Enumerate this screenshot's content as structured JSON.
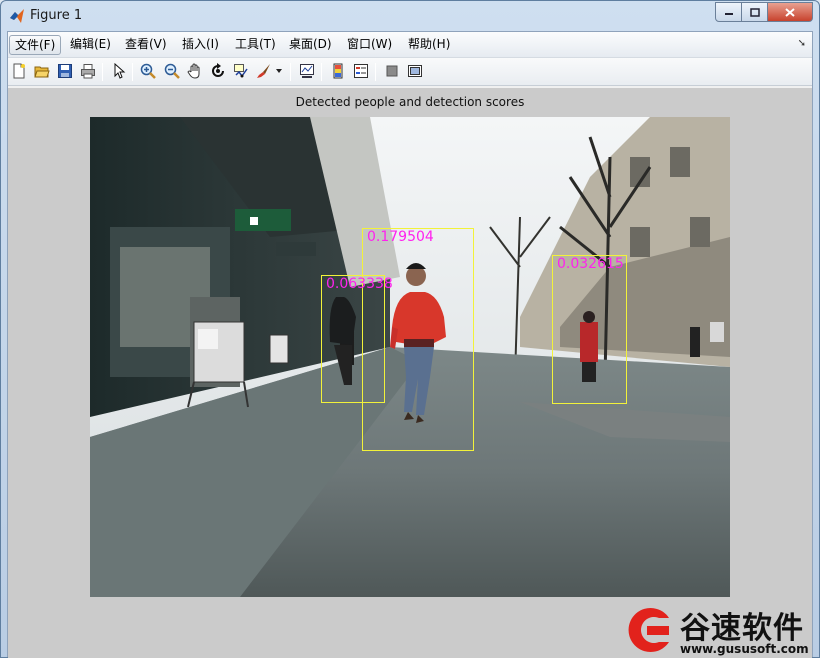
{
  "window": {
    "title": "Figure 1"
  },
  "menu": [
    {
      "label": "文件(F)",
      "active": true
    },
    {
      "label": "编辑(E)"
    },
    {
      "label": "查看(V)"
    },
    {
      "label": "插入(I)"
    },
    {
      "label": "工具(T)"
    },
    {
      "label": "桌面(D)"
    },
    {
      "label": "窗口(W)"
    },
    {
      "label": "帮助(H)"
    }
  ],
  "toolbar": {
    "icons": [
      "new-figure-icon",
      "open-file-icon",
      "save-icon",
      "print-icon",
      "edit-plot-icon",
      "zoom-in-icon",
      "zoom-out-icon",
      "pan-icon",
      "rotate-3d-icon",
      "data-cursor-icon",
      "brush-icon",
      "link-plot-icon",
      "colorbar-icon",
      "legend-icon",
      "hide-plot-tools-icon",
      "show-plot-tools-icon"
    ]
  },
  "figure": {
    "title": "Detected people and detection scores",
    "detections": [
      {
        "label": "0.179504"
      },
      {
        "label": "0.063338"
      },
      {
        "label": "0.032615"
      }
    ]
  },
  "watermark": {
    "name": "谷速软件",
    "url": "www.gususoft.com"
  },
  "colors": {
    "box": "#f2f23a",
    "score": "#ff22ee",
    "figure_bg": "#cbcbcb"
  }
}
